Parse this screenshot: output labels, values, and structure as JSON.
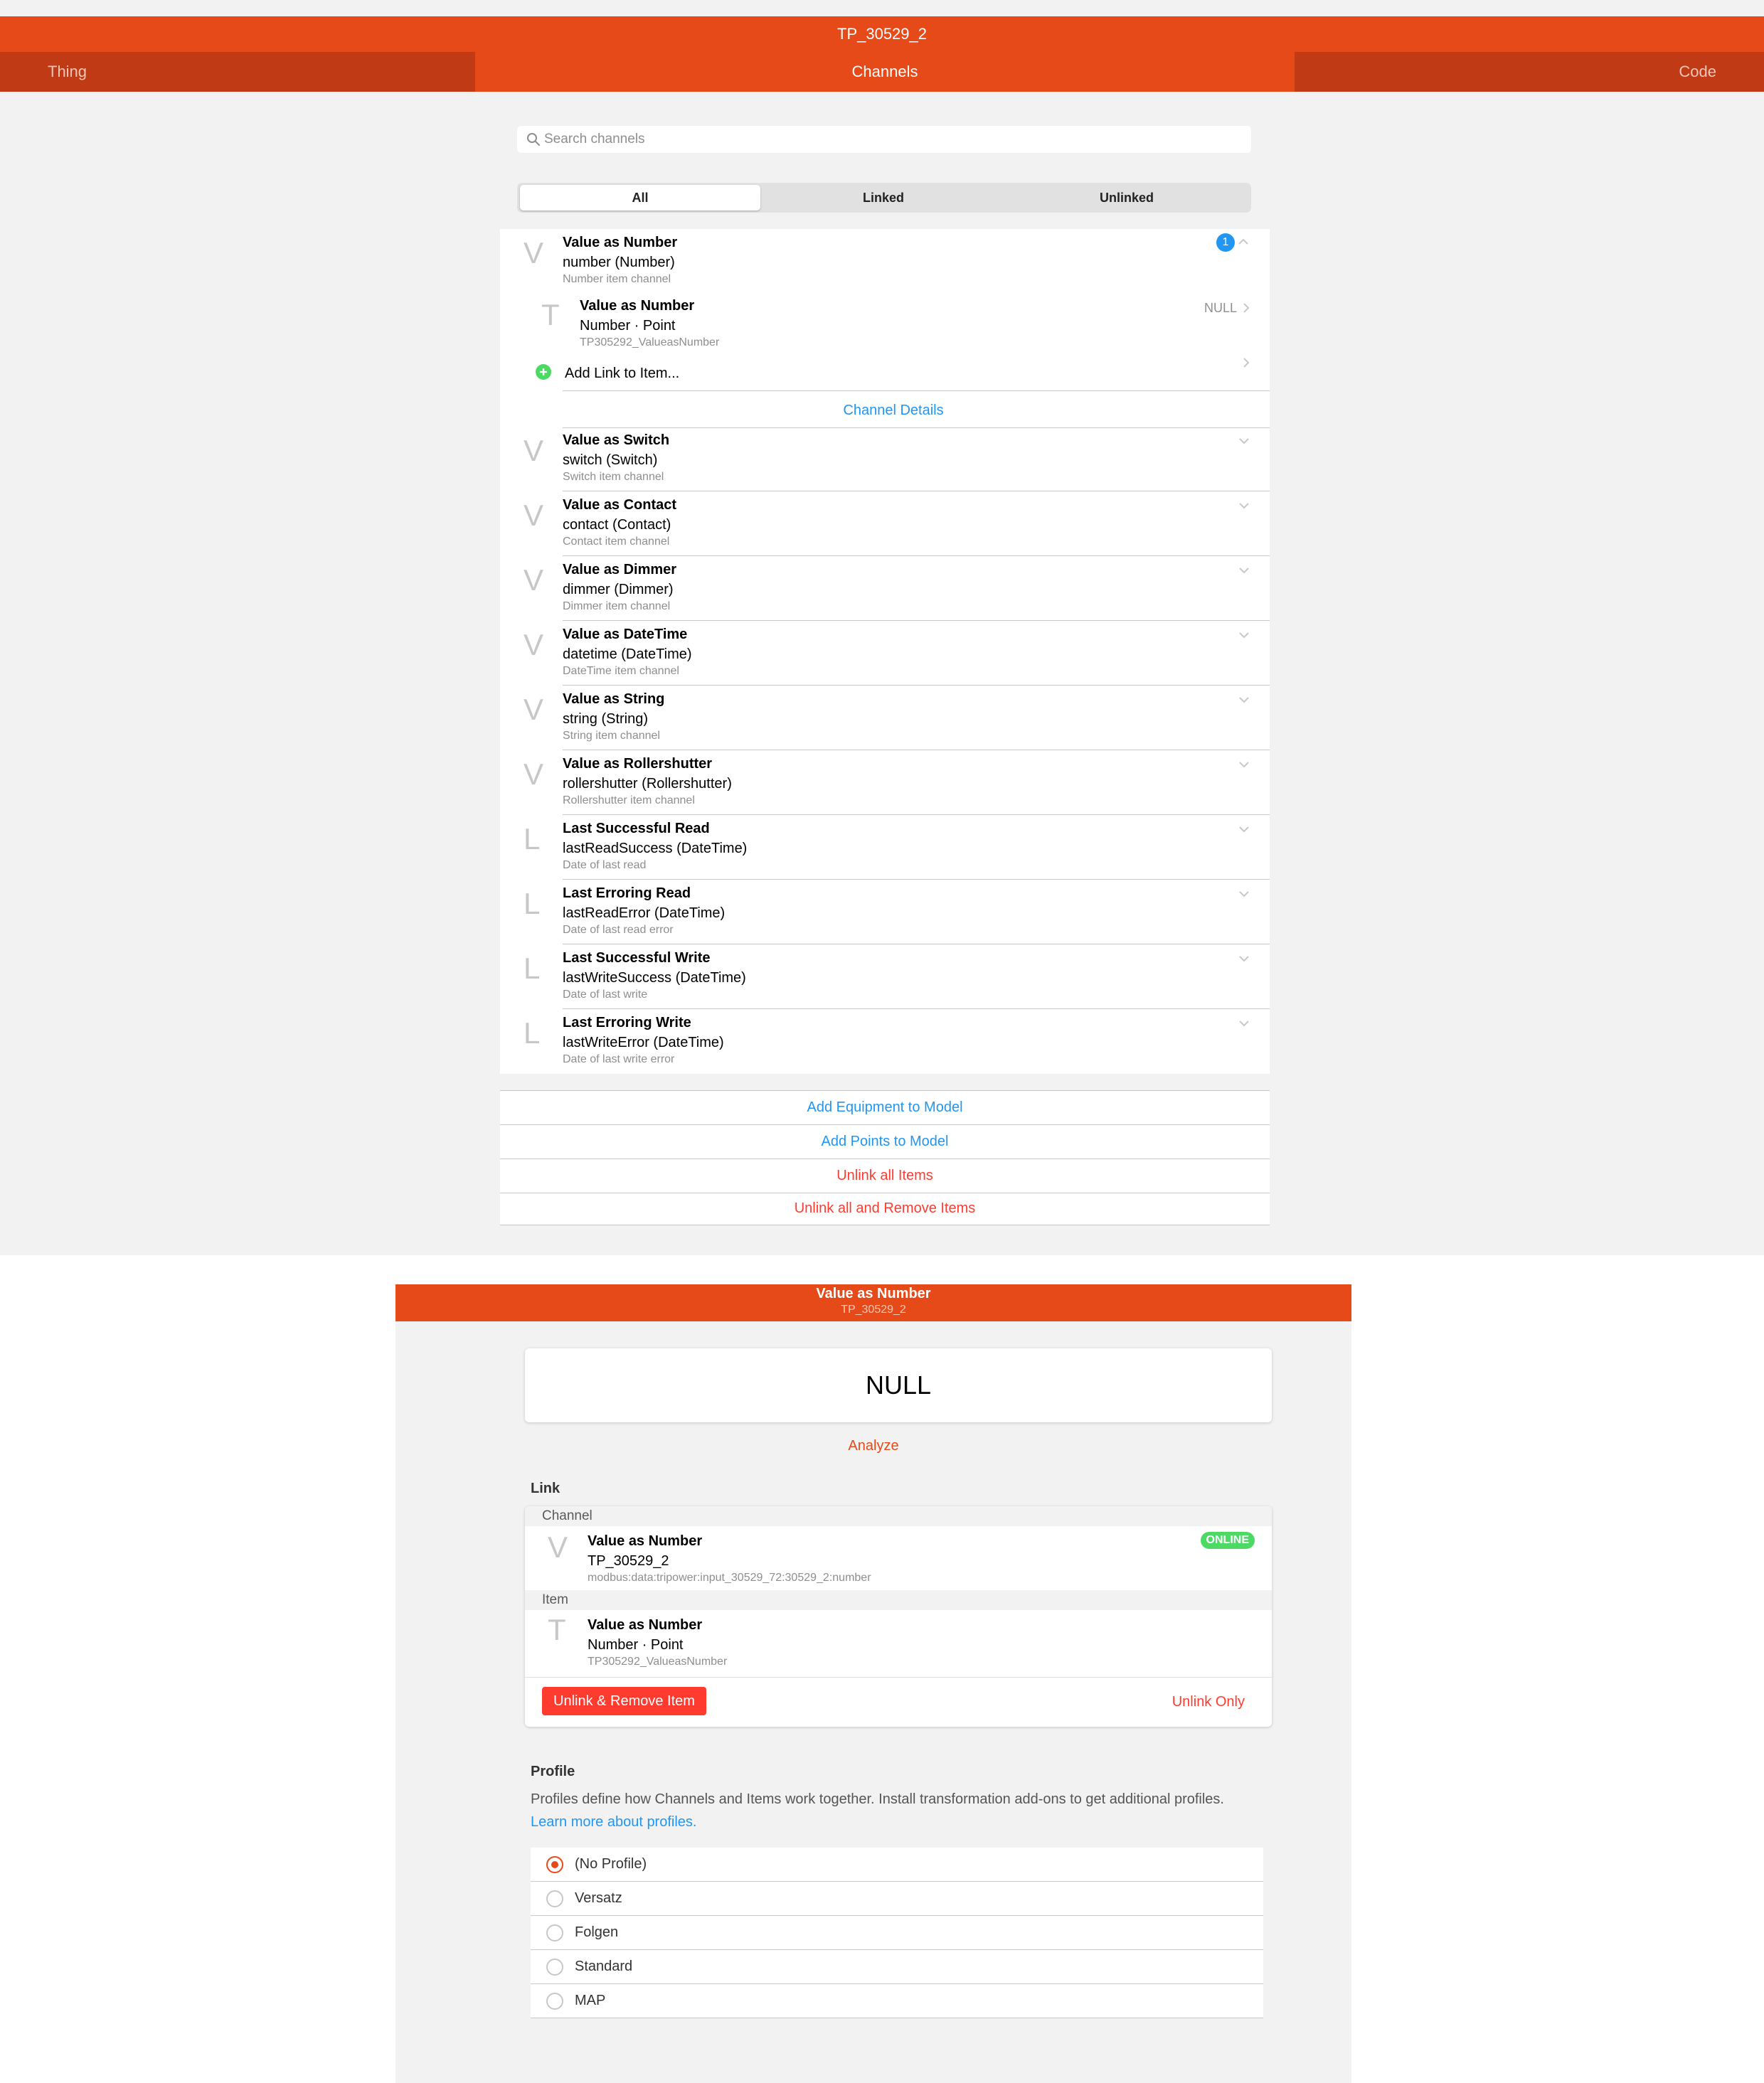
{
  "top": {
    "title": "TP_30529_2",
    "tabs": [
      {
        "label": "Thing"
      },
      {
        "label": "Channels"
      },
      {
        "label": "Code"
      }
    ],
    "search_placeholder": "Search channels",
    "filters": [
      "All",
      "Linked",
      "Unlinked"
    ],
    "expanded_channel": {
      "letter": "V",
      "title": "Value as Number",
      "subtitle": "number (Number)",
      "footer": "Number item channel",
      "badge": "1"
    },
    "linked_item": {
      "letter": "T",
      "title": "Value as Number",
      "subtitle": "Number · Point",
      "footer": "TP305292_ValueasNumber",
      "state": "NULL"
    },
    "add_link_label": "Add Link to Item...",
    "channel_details_label": "Channel Details",
    "channels": [
      {
        "letter": "V",
        "title": "Value as Switch",
        "subtitle": "switch (Switch)",
        "footer": "Switch item channel"
      },
      {
        "letter": "V",
        "title": "Value as Contact",
        "subtitle": "contact (Contact)",
        "footer": "Contact item channel"
      },
      {
        "letter": "V",
        "title": "Value as Dimmer",
        "subtitle": "dimmer (Dimmer)",
        "footer": "Dimmer item channel"
      },
      {
        "letter": "V",
        "title": "Value as DateTime",
        "subtitle": "datetime (DateTime)",
        "footer": "DateTime item channel"
      },
      {
        "letter": "V",
        "title": "Value as String",
        "subtitle": "string (String)",
        "footer": "String item channel"
      },
      {
        "letter": "V",
        "title": "Value as Rollershutter",
        "subtitle": "rollershutter (Rollershutter)",
        "footer": "Rollershutter item channel"
      },
      {
        "letter": "L",
        "title": "Last Successful Read",
        "subtitle": "lastReadSuccess (DateTime)",
        "footer": "Date of last read"
      },
      {
        "letter": "L",
        "title": "Last Erroring Read",
        "subtitle": "lastReadError (DateTime)",
        "footer": "Date of last read error"
      },
      {
        "letter": "L",
        "title": "Last Successful Write",
        "subtitle": "lastWriteSuccess (DateTime)",
        "footer": "Date of last write"
      },
      {
        "letter": "L",
        "title": "Last Erroring Write",
        "subtitle": "lastWriteError (DateTime)",
        "footer": "Date of last write error"
      }
    ],
    "actions": {
      "add_equipment": "Add Equipment to Model",
      "add_points": "Add Points to Model",
      "unlink_all": "Unlink all Items",
      "unlink_remove_all": "Unlink all and Remove Items"
    }
  },
  "bottom": {
    "title": "Value as Number",
    "subtitle": "TP_30529_2",
    "state_value": "NULL",
    "analyze_label": "Analyze",
    "link_heading": "Link",
    "channel_group_label": "Channel",
    "channel": {
      "letter": "V",
      "title": "Value as Number",
      "subtitle": "TP_30529_2",
      "footer": "modbus:data:tripower:input_30529_72:30529_2:number",
      "status": "ONLINE"
    },
    "item_group_label": "Item",
    "item": {
      "letter": "T",
      "title": "Value as Number",
      "subtitle": "Number · Point",
      "footer": "TP305292_ValueasNumber"
    },
    "unlink_remove_label": "Unlink & Remove Item",
    "unlink_only_label": "Unlink Only",
    "profile_heading": "Profile",
    "profile_description": "Profiles define how Channels and Items work together. Install transformation add-ons to get additional profiles.",
    "profile_learn_more": "Learn more about profiles.",
    "profiles": [
      {
        "label": "(No Profile)",
        "selected": true
      },
      {
        "label": "Versatz",
        "selected": false
      },
      {
        "label": "Folgen",
        "selected": false
      },
      {
        "label": "Standard",
        "selected": false
      },
      {
        "label": "MAP",
        "selected": false
      }
    ]
  },
  "colors": {
    "accent": "#e64a19",
    "accent_dark": "#bf3a15",
    "link_blue": "#2196f3",
    "destructive_red": "#ff3b30",
    "online_green": "#4cd964"
  }
}
